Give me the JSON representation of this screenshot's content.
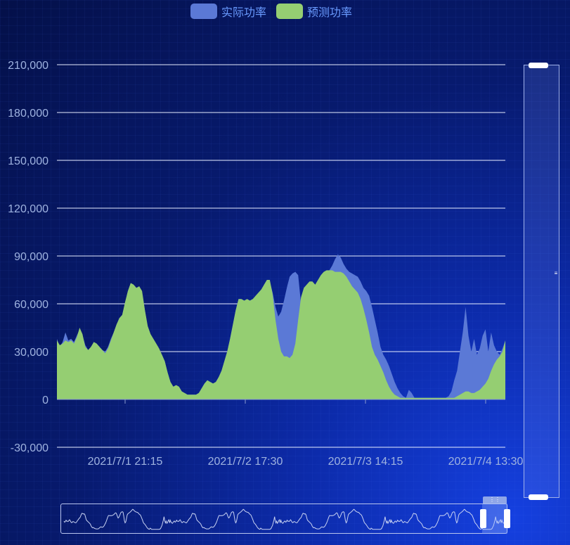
{
  "legend": {
    "actual_label": "实际功率",
    "forecast_label": "预测功率",
    "actual_color": "#5b79d6",
    "forecast_color": "#95ce72"
  },
  "chart_data": {
    "type": "area",
    "yticks": [
      "210,000",
      "180,000",
      "150,000",
      "120,000",
      "90,000",
      "60,000",
      "30,000",
      "0",
      "-30,000"
    ],
    "ylim": [
      -30000,
      210000
    ],
    "xticks": [
      "2021/7/1 21:15",
      "2021/7/2 17:30",
      "2021/7/3 14:15",
      "2021/7/4 13:30"
    ],
    "grid": true,
    "legend_position": "top-center",
    "series": [
      {
        "name": "实际功率",
        "color": "#5b79d6",
        "values": [
          38000,
          33000,
          36000,
          42000,
          37000,
          38000,
          36000,
          40000,
          44000,
          40000,
          34000,
          31000,
          33000,
          36000,
          35000,
          33000,
          31000,
          30000,
          33000,
          38000,
          42000,
          47000,
          51000,
          53000,
          60000,
          68000,
          73000,
          72000,
          70000,
          71000,
          67000,
          56000,
          45000,
          40000,
          37000,
          34000,
          31000,
          28000,
          24000,
          16000,
          11000,
          8000,
          9000,
          8000,
          5000,
          4000,
          3000,
          3000,
          3000,
          3000,
          4000,
          7000,
          10000,
          12000,
          11000,
          10000,
          11000,
          14000,
          18000,
          24000,
          30000,
          38000,
          47000,
          56000,
          63000,
          63000,
          62000,
          63000,
          62000,
          63000,
          64000,
          66000,
          68000,
          72000,
          75000,
          74000,
          67000,
          58000,
          52000,
          55000,
          62000,
          70000,
          77000,
          79000,
          80000,
          78000,
          60000,
          40000,
          30000,
          35000,
          50000,
          66000,
          71000,
          73000,
          76000,
          78000,
          81000,
          84000,
          88000,
          91000,
          89000,
          85000,
          82000,
          80000,
          79000,
          78000,
          77000,
          74000,
          70000,
          68000,
          65000,
          58000,
          50000,
          42000,
          33000,
          28000,
          25000,
          21000,
          16000,
          11000,
          7000,
          4000,
          2000,
          1000,
          6000,
          4000,
          1000,
          1000,
          1000,
          1000,
          1000,
          1000,
          1000,
          1000,
          1000,
          1000,
          1000,
          1000,
          2000,
          5000,
          12000,
          18000,
          30000,
          42000,
          58000,
          40000,
          30000,
          38000,
          28000,
          32000,
          40000,
          44000,
          30000,
          42000,
          34000,
          30000,
          28000,
          32000,
          37000
        ],
        "y_values_note_removed": null
      },
      {
        "name": "预测功率",
        "color": "#95ce72",
        "values": [
          37000,
          34000,
          35000,
          37000,
          36000,
          37000,
          35000,
          39000,
          45000,
          41000,
          33000,
          31000,
          33000,
          36000,
          35000,
          33000,
          31000,
          29000,
          32000,
          37000,
          42000,
          47000,
          51000,
          53000,
          61000,
          68000,
          73000,
          72000,
          70000,
          71000,
          68000,
          56000,
          46000,
          41000,
          38000,
          35000,
          32000,
          28000,
          24000,
          17000,
          11000,
          8000,
          9000,
          8000,
          5000,
          4000,
          3000,
          3000,
          3000,
          3000,
          4000,
          7000,
          10000,
          12000,
          11000,
          10000,
          11000,
          14000,
          18000,
          24000,
          30000,
          38000,
          47000,
          56000,
          63000,
          63000,
          62000,
          63000,
          62000,
          63000,
          65000,
          67000,
          69000,
          72000,
          75000,
          75000,
          66000,
          50000,
          38000,
          30000,
          27000,
          27000,
          26000,
          28000,
          35000,
          50000,
          64000,
          70000,
          72000,
          74000,
          74000,
          72000,
          75000,
          78000,
          80000,
          81000,
          81000,
          81000,
          80000,
          80000,
          80000,
          79000,
          77000,
          74000,
          71000,
          69000,
          67000,
          63000,
          57000,
          50000,
          42000,
          33000,
          28000,
          25000,
          21000,
          17000,
          12000,
          8000,
          5000,
          3000,
          2000,
          1000,
          1000,
          1000,
          1000,
          1000,
          1000,
          1000,
          1000,
          1000,
          1000,
          1000,
          1000,
          1000,
          1000,
          1000,
          1000,
          1000,
          1000,
          1000,
          1000,
          2000,
          3000,
          4000,
          5000,
          5000,
          4000,
          4000,
          5000,
          6000,
          8000,
          10000,
          13000,
          18000,
          22000,
          25000,
          27000,
          30000,
          37000
        ]
      }
    ]
  }
}
